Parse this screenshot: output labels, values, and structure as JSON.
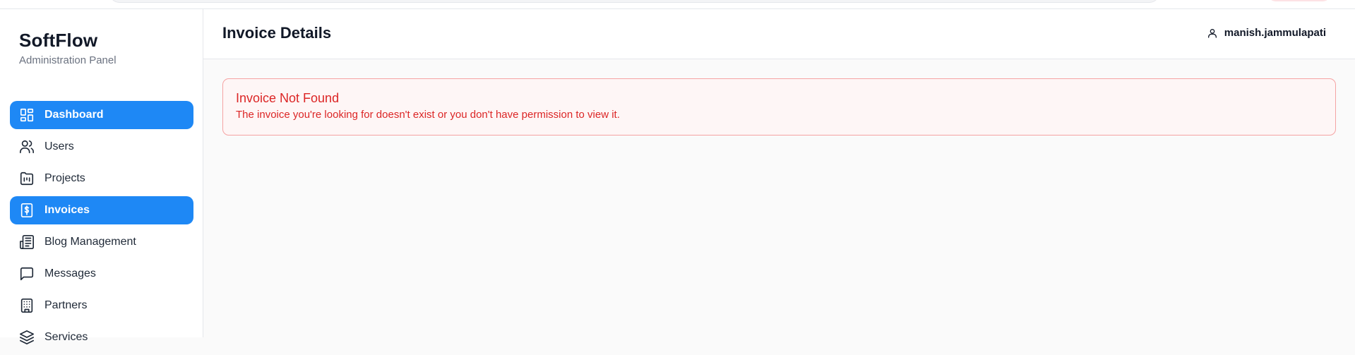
{
  "app": {
    "name": "SoftFlow",
    "subtitle": "Administration Panel"
  },
  "sidebar": {
    "items": [
      {
        "label": "Dashboard",
        "icon": "dashboard-icon",
        "active": true
      },
      {
        "label": "Users",
        "icon": "users-icon",
        "active": false
      },
      {
        "label": "Projects",
        "icon": "projects-icon",
        "active": false
      },
      {
        "label": "Invoices",
        "icon": "invoice-icon",
        "active": true
      },
      {
        "label": "Blog Management",
        "icon": "newspaper-icon",
        "active": false
      },
      {
        "label": "Messages",
        "icon": "message-icon",
        "active": false
      },
      {
        "label": "Partners",
        "icon": "building-icon",
        "active": false
      },
      {
        "label": "Services",
        "icon": "layers-icon",
        "active": false
      }
    ]
  },
  "header": {
    "title": "Invoice Details",
    "username": "manish.jammulapati"
  },
  "error": {
    "title": "Invoice Not Found",
    "message": "The invoice you're looking for doesn't exist or you don't have permission to view it."
  },
  "colors": {
    "accent": "#1e88f5",
    "error": "#dc2626",
    "error_border": "#f5a3a3"
  }
}
